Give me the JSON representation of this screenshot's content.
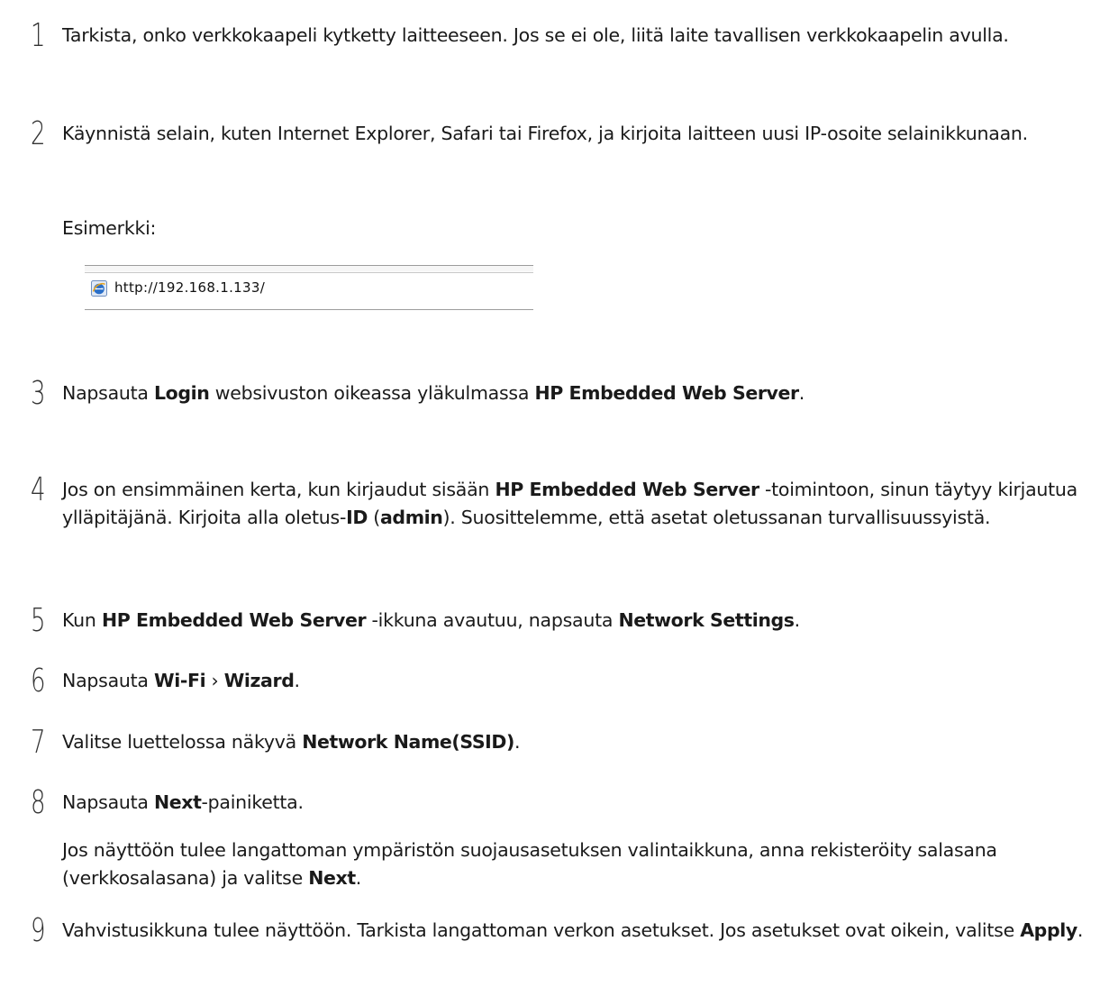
{
  "steps": [
    {
      "num": "1",
      "parts": [
        {
          "t": "Tarkista, onko verkkokaapeli kytketty laitteeseen. Jos se ei ole, liitä laite tavallisen verkkokaapelin avulla.",
          "b": false
        }
      ]
    },
    {
      "num": "2",
      "parts": [
        {
          "t": "Käynnistä selain, kuten Internet Explorer, Safari tai Firefox, ja kirjoita laitteen uusi IP-osoite selainikkunaan.",
          "b": false
        }
      ],
      "note": "Esimerkki:"
    },
    {
      "num": "3",
      "parts": [
        {
          "t": "Napsauta ",
          "b": false
        },
        {
          "t": "Login",
          "b": true
        },
        {
          "t": " websivuston oikeassa yläkulmassa ",
          "b": false
        },
        {
          "t": "HP Embedded Web Server",
          "b": true
        },
        {
          "t": ".",
          "b": false
        }
      ]
    },
    {
      "num": "4",
      "parts": [
        {
          "t": "Jos on ensimmäinen kerta, kun kirjaudut sisään ",
          "b": false
        },
        {
          "t": "HP Embedded Web Server",
          "b": true
        },
        {
          "t": " -toimintoon, sinun täytyy kirjautua ylläpitäjänä. Kirjoita alla oletus-",
          "b": false
        },
        {
          "t": "ID",
          "b": true
        },
        {
          "t": " (",
          "b": false
        },
        {
          "t": "admin",
          "b": true
        },
        {
          "t": "). Suosittelemme, että asetat oletussanan turvallisuussyistä.",
          "b": false
        }
      ]
    },
    {
      "num": "5",
      "parts": [
        {
          "t": "Kun ",
          "b": false
        },
        {
          "t": "HP Embedded Web Server",
          "b": true
        },
        {
          "t": " -ikkuna avautuu, napsauta ",
          "b": false
        },
        {
          "t": "Network Settings",
          "b": true
        },
        {
          "t": ".",
          "b": false
        }
      ]
    },
    {
      "num": "6",
      "parts": [
        {
          "t": "Napsauta ",
          "b": false
        },
        {
          "t": "Wi-Fi",
          "b": true
        },
        {
          "t": " › ",
          "b": false
        },
        {
          "t": "Wizard",
          "b": true
        },
        {
          "t": ".",
          "b": false
        }
      ]
    },
    {
      "num": "7",
      "parts": [
        {
          "t": "Valitse luettelossa näkyvä ",
          "b": false
        },
        {
          "t": "Network Name(SSID)",
          "b": true
        },
        {
          "t": ".",
          "b": false
        }
      ]
    },
    {
      "num": "8",
      "parts": [
        {
          "t": "Napsauta ",
          "b": false
        },
        {
          "t": "Next",
          "b": true
        },
        {
          "t": "-painiketta.",
          "b": false
        }
      ],
      "note_parts": [
        {
          "t": "Jos näyttöön tulee langattoman ympäristön suojausasetuksen valintaikkuna, anna rekisteröity salasana (verkkosalasana) ja valitse ",
          "b": false
        },
        {
          "t": "Next",
          "b": true
        },
        {
          "t": ".",
          "b": false
        }
      ]
    },
    {
      "num": "9",
      "parts": [
        {
          "t": "Vahvistusikkuna tulee näyttöön. Tarkista langattoman verkon asetukset. Jos asetukset ovat oikein, valitse ",
          "b": false
        },
        {
          "t": "Apply",
          "b": true
        },
        {
          "t": ".",
          "b": false
        }
      ]
    }
  ],
  "example_url": "http://192.168.1.133/",
  "icons": {
    "browser": "internet-explorer-icon"
  },
  "colors": {
    "text": "#1a1a1a",
    "number": "#333333",
    "ie_blue": "#2a6fc9"
  }
}
